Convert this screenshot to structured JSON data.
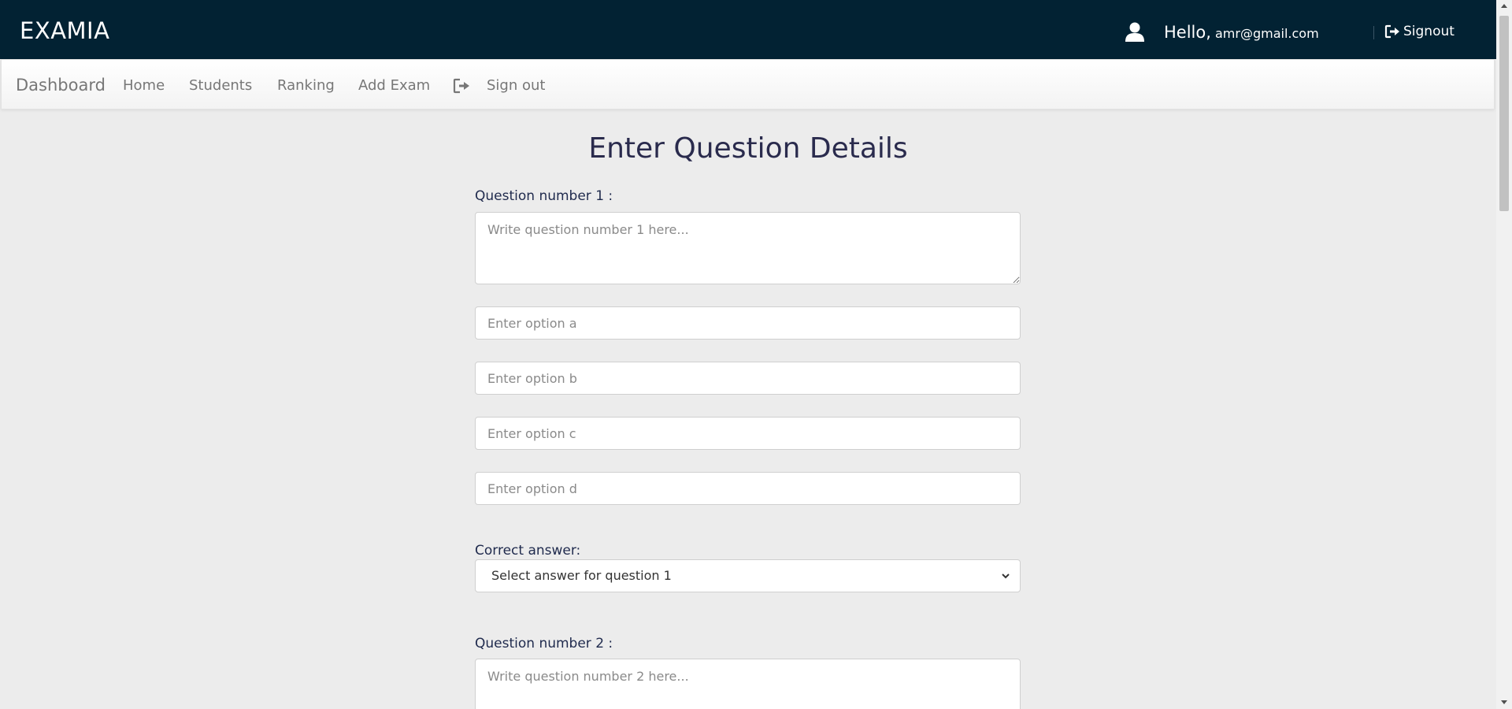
{
  "header": {
    "brand": "EXAMIA",
    "greeting": "Hello,",
    "email": "amr@gmail.com",
    "signout_label": "Signout"
  },
  "navbar": {
    "dashboard": "Dashboard",
    "items": [
      "Home",
      "Students",
      "Ranking",
      "Add Exam"
    ],
    "signout_label": "Sign out"
  },
  "form": {
    "title": "Enter Question Details",
    "questions": [
      {
        "label": "Question number 1 :",
        "placeholder": "Write question number 1 here...",
        "options": [
          "Enter option a",
          "Enter option b",
          "Enter option c",
          "Enter option d"
        ],
        "answer_label": "Correct answer:",
        "answer_select": "Select answer for question 1"
      },
      {
        "label": "Question number 2 :",
        "placeholder": "Write question number 2 here..."
      }
    ]
  },
  "icons": {
    "user": "user-icon",
    "signout": "signout-icon",
    "chevron": "chevron-down-icon"
  },
  "colors": {
    "header_bg": "#022233",
    "page_bg": "#ececec",
    "title": "#2a2b4d"
  }
}
